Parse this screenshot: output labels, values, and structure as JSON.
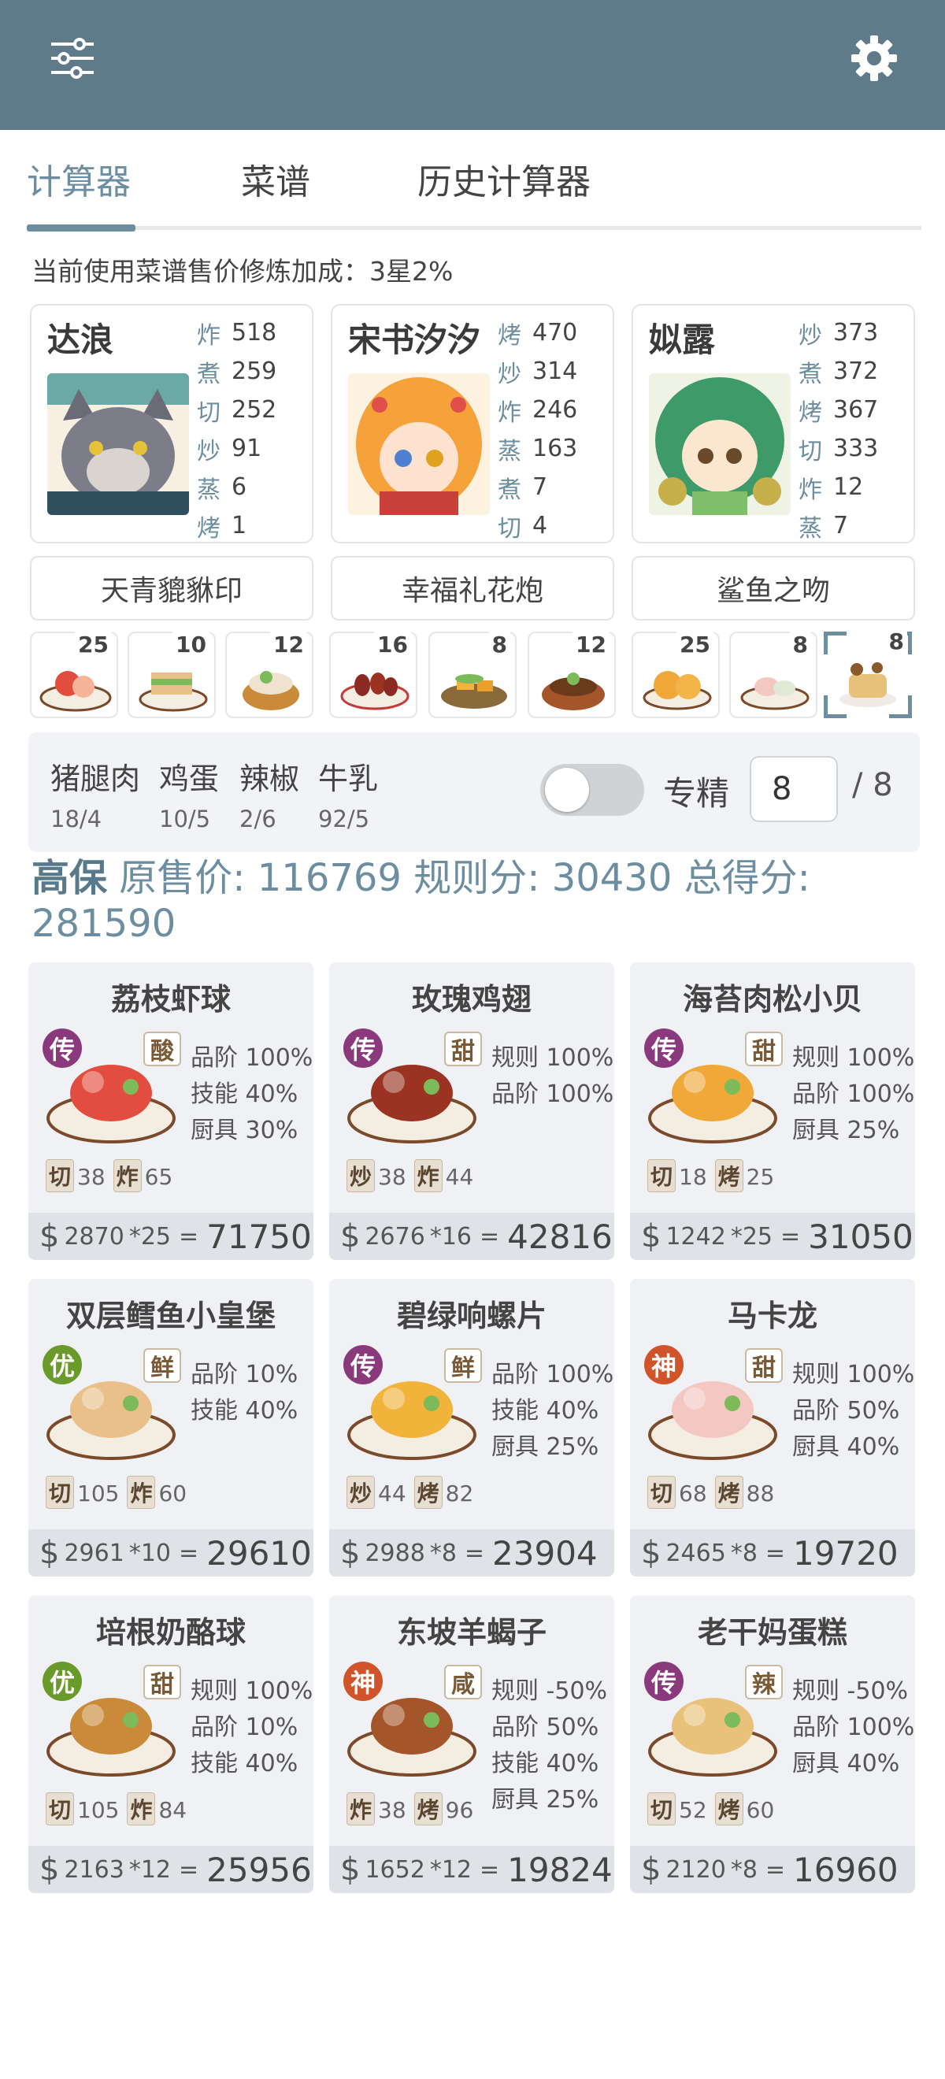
{
  "topbar": {
    "menu_icon": "sliders-icon",
    "settings_icon": "gear-icon",
    "color": "#5f7a88"
  },
  "tabs": [
    {
      "label": "计算器",
      "active": true
    },
    {
      "label": "菜谱",
      "active": false
    },
    {
      "label": "历史计算器",
      "active": false
    }
  ],
  "bonus_text": "当前使用菜谱售价修炼加成：3星2%",
  "chefs": [
    {
      "name": "达浪",
      "stats": [
        {
          "k": "炸",
          "v": "518"
        },
        {
          "k": "煮",
          "v": "259"
        },
        {
          "k": "切",
          "v": "252"
        },
        {
          "k": "炒",
          "v": "91"
        },
        {
          "k": "蒸",
          "v": "6"
        },
        {
          "k": "烤",
          "v": "1"
        }
      ]
    },
    {
      "name": "宋书汐汐",
      "stats": [
        {
          "k": "烤",
          "v": "470"
        },
        {
          "k": "炒",
          "v": "314"
        },
        {
          "k": "炸",
          "v": "246"
        },
        {
          "k": "蒸",
          "v": "163"
        },
        {
          "k": "煮",
          "v": "7"
        },
        {
          "k": "切",
          "v": "4"
        }
      ]
    },
    {
      "name": "姒露",
      "stats": [
        {
          "k": "炒",
          "v": "373"
        },
        {
          "k": "煮",
          "v": "372"
        },
        {
          "k": "烤",
          "v": "367"
        },
        {
          "k": "切",
          "v": "333"
        },
        {
          "k": "炸",
          "v": "12"
        },
        {
          "k": "蒸",
          "v": "7"
        }
      ]
    }
  ],
  "equipment": [
    "天青貔貅印",
    "幸福礼花炮",
    "鲨鱼之吻"
  ],
  "dish_quantities": [
    "25",
    "10",
    "12",
    "16",
    "8",
    "12",
    "25",
    "8",
    "8"
  ],
  "ingredients": [
    {
      "name": "猪腿肉",
      "count": "18/4"
    },
    {
      "name": "鸡蛋",
      "count": "10/5"
    },
    {
      "name": "辣椒",
      "count": "2/6"
    },
    {
      "name": "牛乳",
      "count": "92/5"
    }
  ],
  "specialize": {
    "label": "专精",
    "value": "8",
    "max": "/ 8",
    "enabled": false
  },
  "summary": {
    "level": "高保",
    "orig_label": "原售价:",
    "orig_value": "116769",
    "rule_label": "规则分:",
    "rule_value": "30430",
    "total_label": "总得分:",
    "total_value": "281590"
  },
  "recipes": [
    {
      "name": "荔枝虾球",
      "rarity": "传",
      "taste": "酸",
      "bonuses": [
        "品阶 100%",
        "技能 40%",
        "厨具 30%"
      ],
      "skills": [
        {
          "k": "切",
          "v": "38"
        },
        {
          "k": "炸",
          "v": "65"
        }
      ],
      "price": "2870",
      "qty": "*25",
      "eq": "=",
      "total": "71750"
    },
    {
      "name": "玫瑰鸡翅",
      "rarity": "传",
      "taste": "甜",
      "bonuses": [
        "规则 100%",
        "品阶 100%"
      ],
      "skills": [
        {
          "k": "炒",
          "v": "38"
        },
        {
          "k": "炸",
          "v": "44"
        }
      ],
      "price": "2676",
      "qty": "*16",
      "eq": "=",
      "total": "42816"
    },
    {
      "name": "海苔肉松小贝",
      "rarity": "传",
      "taste": "甜",
      "bonuses": [
        "规则 100%",
        "品阶 100%",
        "厨具 25%"
      ],
      "skills": [
        {
          "k": "切",
          "v": "18"
        },
        {
          "k": "烤",
          "v": "25"
        }
      ],
      "price": "1242",
      "qty": "*25",
      "eq": "=",
      "total": "31050"
    },
    {
      "name": "双层鳕鱼小皇堡",
      "rarity": "优",
      "taste": "鲜",
      "bonuses": [
        "品阶 10%",
        "技能 40%"
      ],
      "skills": [
        {
          "k": "切",
          "v": "105"
        },
        {
          "k": "炸",
          "v": "60"
        }
      ],
      "price": "2961",
      "qty": "*10",
      "eq": "=",
      "total": "29610"
    },
    {
      "name": "碧绿响螺片",
      "rarity": "传",
      "taste": "鲜",
      "bonuses": [
        "品阶 100%",
        "技能 40%",
        "厨具 25%"
      ],
      "skills": [
        {
          "k": "炒",
          "v": "44"
        },
        {
          "k": "烤",
          "v": "82"
        }
      ],
      "price": "2988",
      "qty": "*8",
      "eq": "=",
      "total": "23904"
    },
    {
      "name": "马卡龙",
      "rarity": "神",
      "taste": "甜",
      "bonuses": [
        "规则 100%",
        "品阶 50%",
        "厨具 40%"
      ],
      "skills": [
        {
          "k": "切",
          "v": "68"
        },
        {
          "k": "烤",
          "v": "88"
        }
      ],
      "price": "2465",
      "qty": "*8",
      "eq": "=",
      "total": "19720"
    },
    {
      "name": "培根奶酪球",
      "rarity": "优",
      "taste": "甜",
      "bonuses": [
        "规则 100%",
        "品阶 10%",
        "技能 40%"
      ],
      "skills": [
        {
          "k": "切",
          "v": "105"
        },
        {
          "k": "炸",
          "v": "84"
        }
      ],
      "price": "2163",
      "qty": "*12",
      "eq": "=",
      "total": "25956"
    },
    {
      "name": "东坡羊蝎子",
      "rarity": "神",
      "taste": "咸",
      "bonuses": [
        "规则 -50%",
        "品阶 50%",
        "技能 40%",
        "厨具 25%"
      ],
      "skills": [
        {
          "k": "炸",
          "v": "38"
        },
        {
          "k": "烤",
          "v": "96"
        }
      ],
      "price": "1652",
      "qty": "*12",
      "eq": "=",
      "total": "19824"
    },
    {
      "name": "老干妈蛋糕",
      "rarity": "传",
      "taste": "辣",
      "bonuses": [
        "规则 -50%",
        "品阶 100%",
        "厨具 40%"
      ],
      "skills": [
        {
          "k": "切",
          "v": "52"
        },
        {
          "k": "烤",
          "v": "60"
        }
      ],
      "price": "2120",
      "qty": "*8",
      "eq": "=",
      "total": "16960"
    }
  ],
  "colors": {
    "accent": "#6c8ea0",
    "rarity_legend": "#8a3a7c",
    "rarity_god": "#d0532a",
    "rarity_good": "#6a9a2a"
  }
}
